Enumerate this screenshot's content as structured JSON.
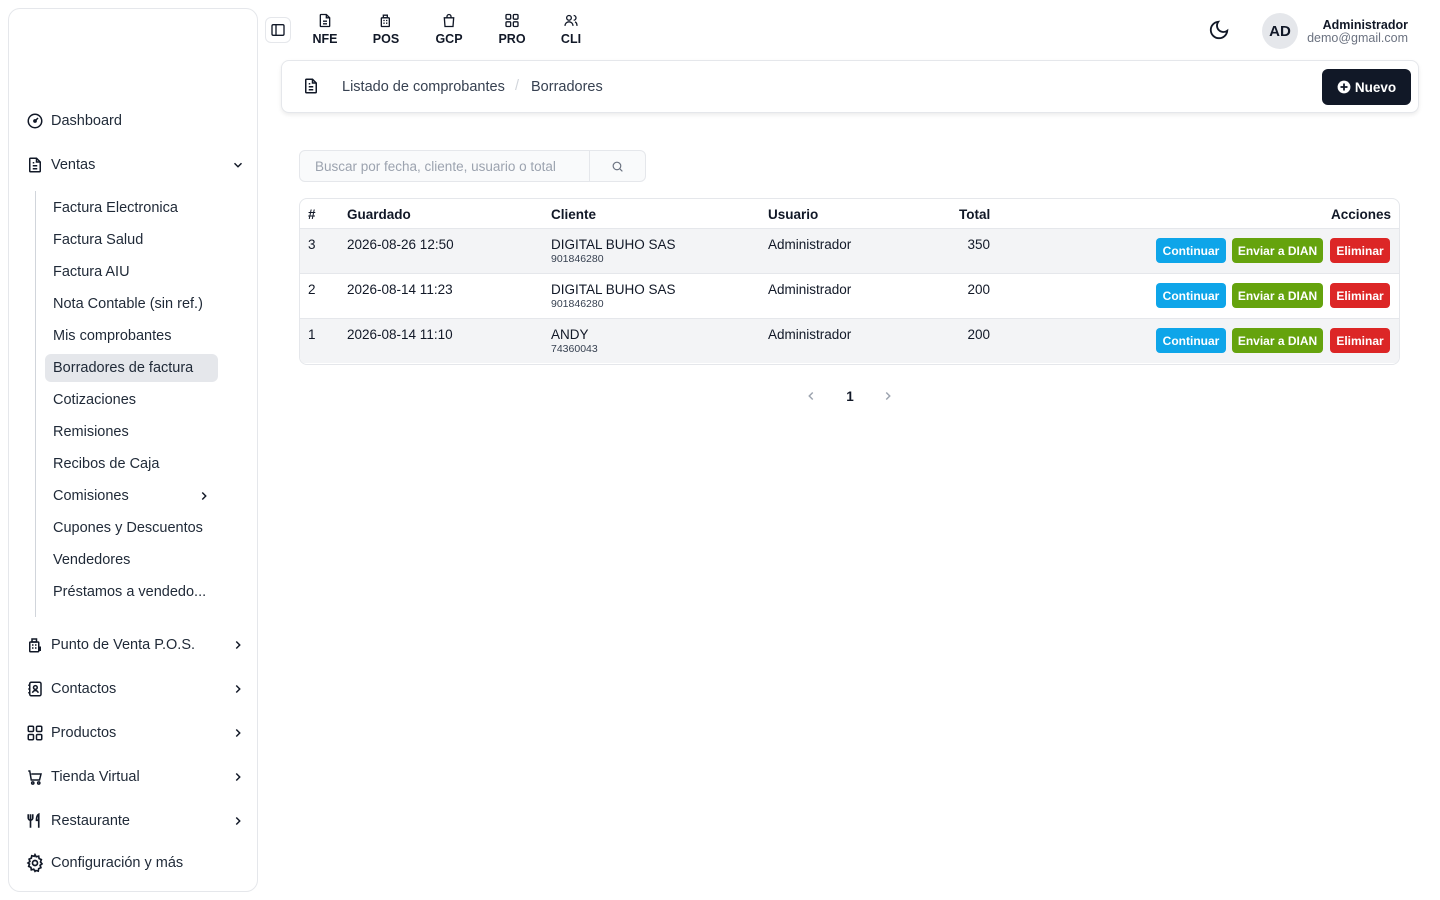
{
  "sidebar": {
    "items": {
      "dashboard": "Dashboard",
      "ventas": "Ventas",
      "pos": "Punto de Venta P.O.S.",
      "contactos": "Contactos",
      "productos": "Productos",
      "tienda": "Tienda Virtual",
      "restaurante": "Restaurante",
      "config": "Configuración y más"
    },
    "ventas_submenu": [
      "Factura Electronica",
      "Factura Salud",
      "Factura AIU",
      "Nota Contable (sin ref.)",
      "Mis comprobantes",
      "Borradores de factura",
      "Cotizaciones",
      "Remisiones",
      "Recibos de Caja",
      "Comisiones",
      "Cupones y Descuentos",
      "Vendedores",
      "Préstamos a vendedo..."
    ],
    "active_submenu": "Borradores de factura"
  },
  "topbar": {
    "apps": [
      "NFE",
      "POS",
      "GCP",
      "PRO",
      "CLI"
    ],
    "avatar_initials": "AD",
    "user_name": "Administrador",
    "user_email": "demo@gmail.com"
  },
  "header": {
    "breadcrumb_1": "Listado de comprobantes",
    "breadcrumb_sep": "/",
    "breadcrumb_2": "Borradores",
    "new_button": "Nuevo"
  },
  "search": {
    "placeholder": "Buscar por fecha, cliente, usuario o total"
  },
  "table": {
    "columns": {
      "num": "#",
      "guardado": "Guardado",
      "cliente": "Cliente",
      "usuario": "Usuario",
      "total": "Total",
      "acciones": "Acciones"
    },
    "rows": [
      {
        "num": "3",
        "guardado": "2026-08-26 12:50",
        "cliente": "DIGITAL BUHO SAS",
        "cliente_id": "901846280",
        "usuario": "Administrador",
        "total": "350"
      },
      {
        "num": "2",
        "guardado": "2026-08-14 11:23",
        "cliente": "DIGITAL BUHO SAS",
        "cliente_id": "901846280",
        "usuario": "Administrador",
        "total": "200"
      },
      {
        "num": "1",
        "guardado": "2026-08-14 11:10",
        "cliente": "ANDY",
        "cliente_id": "74360043",
        "usuario": "Administrador",
        "total": "200"
      }
    ],
    "actions": {
      "continuar": "Continuar",
      "enviar": "Enviar a DIAN",
      "eliminar": "Eliminar"
    }
  },
  "pagination": {
    "current_page": "1"
  },
  "colors": {
    "continuar": "#0ea5e9",
    "enviar": "#65a30d",
    "eliminar": "#dc2626",
    "primary_dark": "#111827"
  }
}
